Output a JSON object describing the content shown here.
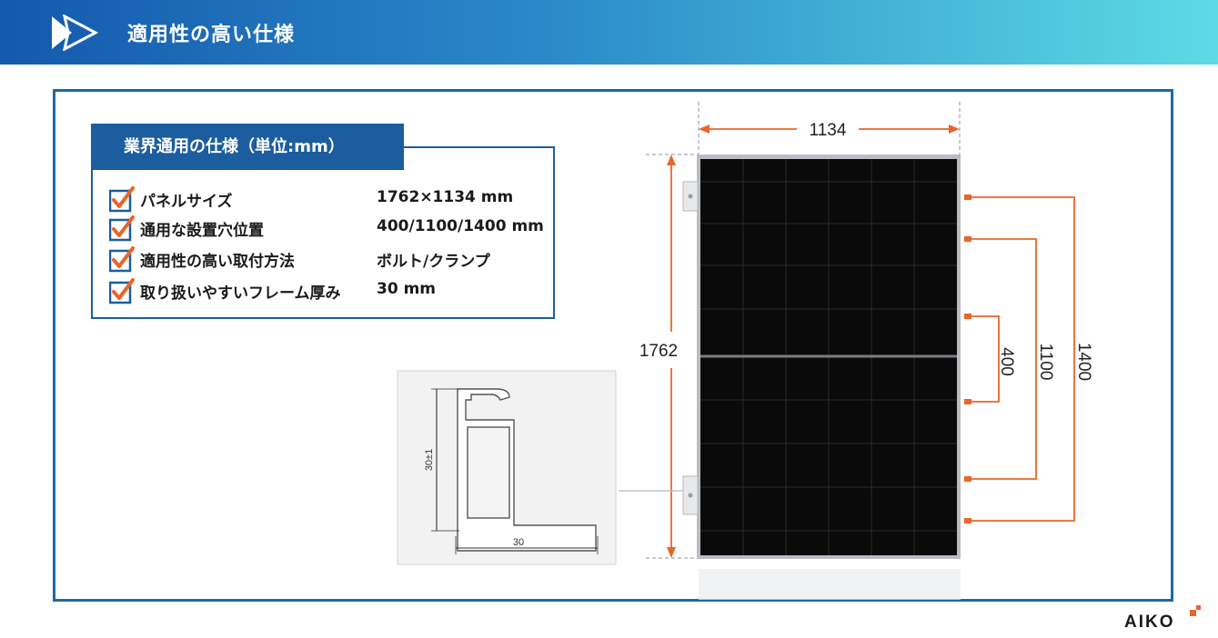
{
  "header": {
    "title": "適用性の高い仕様",
    "logo_icon": "double-chevron-right-icon"
  },
  "spec_card": {
    "title": "業界通用の仕様（単位:mm）",
    "rows": [
      {
        "label": "パネルサイズ",
        "value": "1762×1134 mm"
      },
      {
        "label": "通用な設置穴位置",
        "value": "400/1100/1400 mm"
      },
      {
        "label": "適用性の高い取付方法",
        "value": "ボルト/クランプ"
      },
      {
        "label": "取り扱いやすいフレーム厚み",
        "value": "30 mm"
      }
    ],
    "check_icon": "checkbox-checked-icon"
  },
  "panel_diagram": {
    "width_label": "1134",
    "height_label": "1762",
    "hole_labels": [
      "400",
      "1100",
      "1400"
    ]
  },
  "frame_profile": {
    "height_label": "30±1",
    "width_label": "30"
  },
  "brand": {
    "logo_text": "AIKO"
  },
  "colors": {
    "header_start": "#1459ad",
    "header_end": "#5ddbe5",
    "frame_border": "#1a6aa8",
    "accent_orange": "#e8662a",
    "panel_cell": "#0a0a0a"
  }
}
